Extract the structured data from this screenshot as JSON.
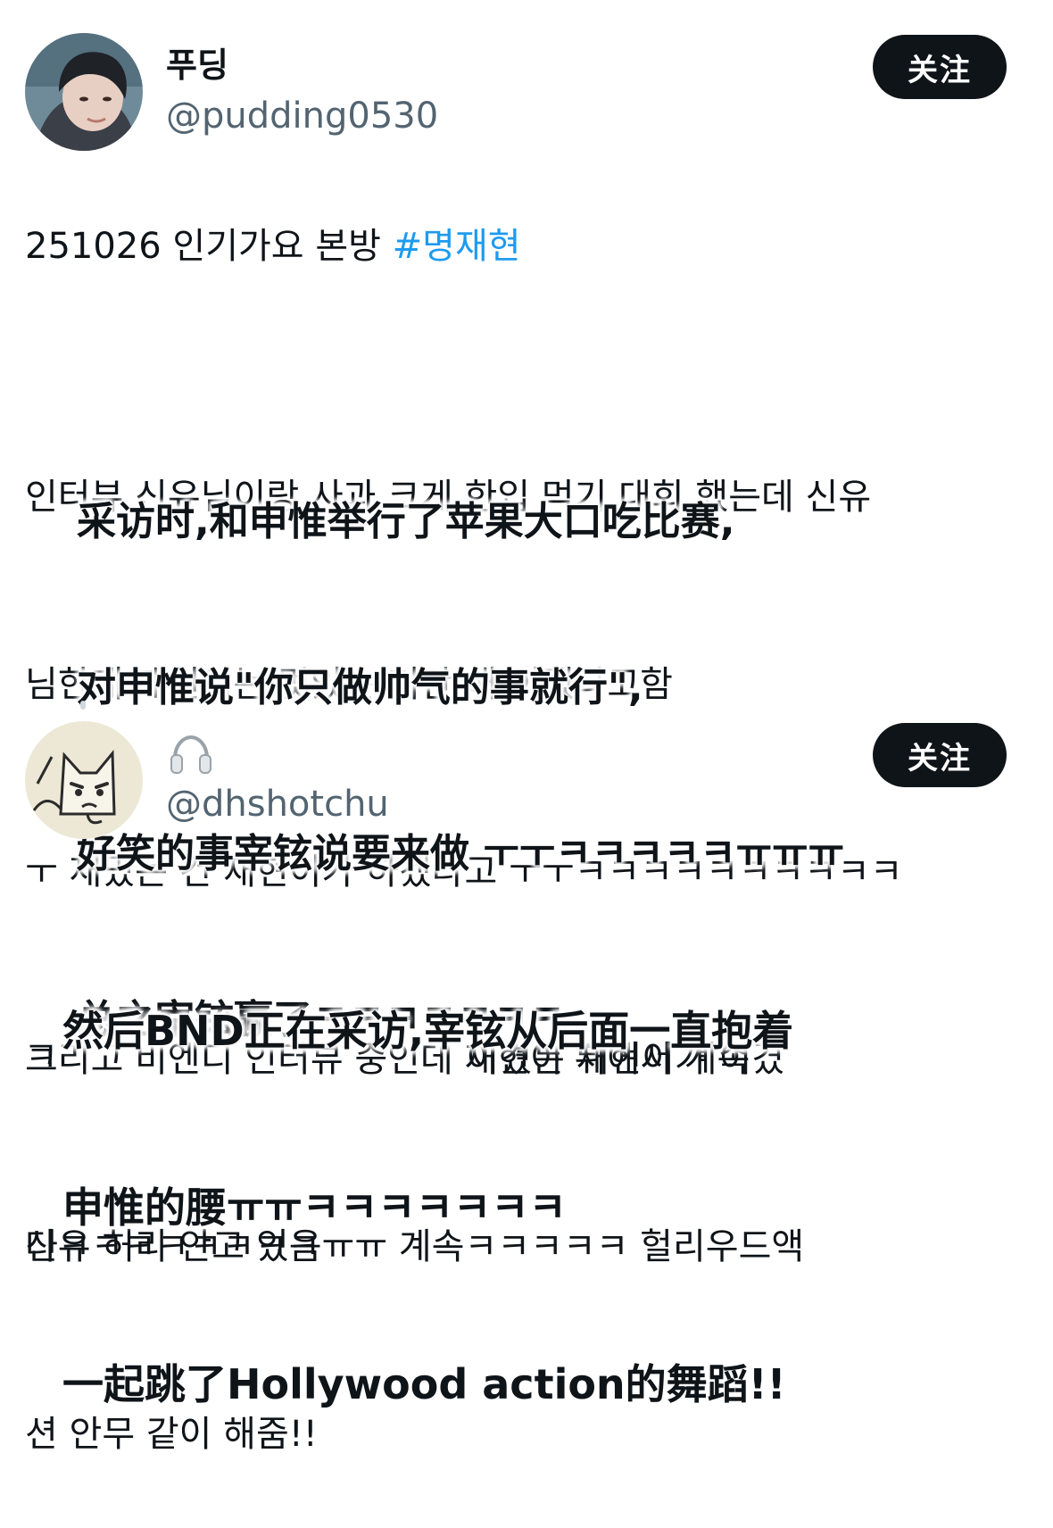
{
  "tweet1": {
    "display_name": "푸딩",
    "handle": "@pudding0530",
    "follow_label": "关注",
    "text_line1_prefix": "251026 인기가요 본방 ",
    "hashtag": "#명재현",
    "underlay_lines": [
      "인터뷰 신유님이랑 사과 크게 한입 먹기 대회 했는데 신유",
      "님한테 재현이는 멋있는 거만 해 이랬다고함",
      "ㅜ 재밌는 건 재현이가 하겠다고 ㅜㅜㅋㅋㅋㅋㅋㅋㅋㅋㅋㅋ",
      "ㅋ                                    이겼든 재현이가 이겼",
      "다ㅋㅋㅋㅋㅋㅋㅋㅋ"
    ],
    "overlay_lines": [
      "采访时,和申惟举行了苹果大口吃比赛,",
      "对申惟说\"你只做帅气的事就行\",",
      "好笑的事宰铉说要来做 ㅜㅜㅋㅋㅋㅋㅋㅠㅠㅠ",
      "总之宰铉赢了ㅋㅋㅋㅋㅋㅋㅋ"
    ]
  },
  "tweet2": {
    "display_name_icon": "headphones-icon",
    "handle": "@dhshotchu",
    "follow_label": "关注",
    "underlay_lines": [
      "그리고 비엔디 인터뷰 중인데 재현이 뒤에서 계속",
      "신유 허리 안고 있음ㅠㅠ 계속ㅋㅋㅋㅋㅋ 헐리우드액",
      "션 안무 같이 해줌!!"
    ],
    "overlay_lines": [
      "然后BND正在采访,宰铉从后面一直抱着",
      "申惟的腰ㅠㅠㅋㅋㅋㅋㅋㅋㅋ",
      "一起跳了Hollywood action的舞蹈!!"
    ]
  },
  "colors": {
    "text": "#0f1419",
    "secondary": "#536471",
    "hashtag": "#1d9bf0",
    "button_bg": "#0f1419",
    "button_text": "#ffffff"
  }
}
